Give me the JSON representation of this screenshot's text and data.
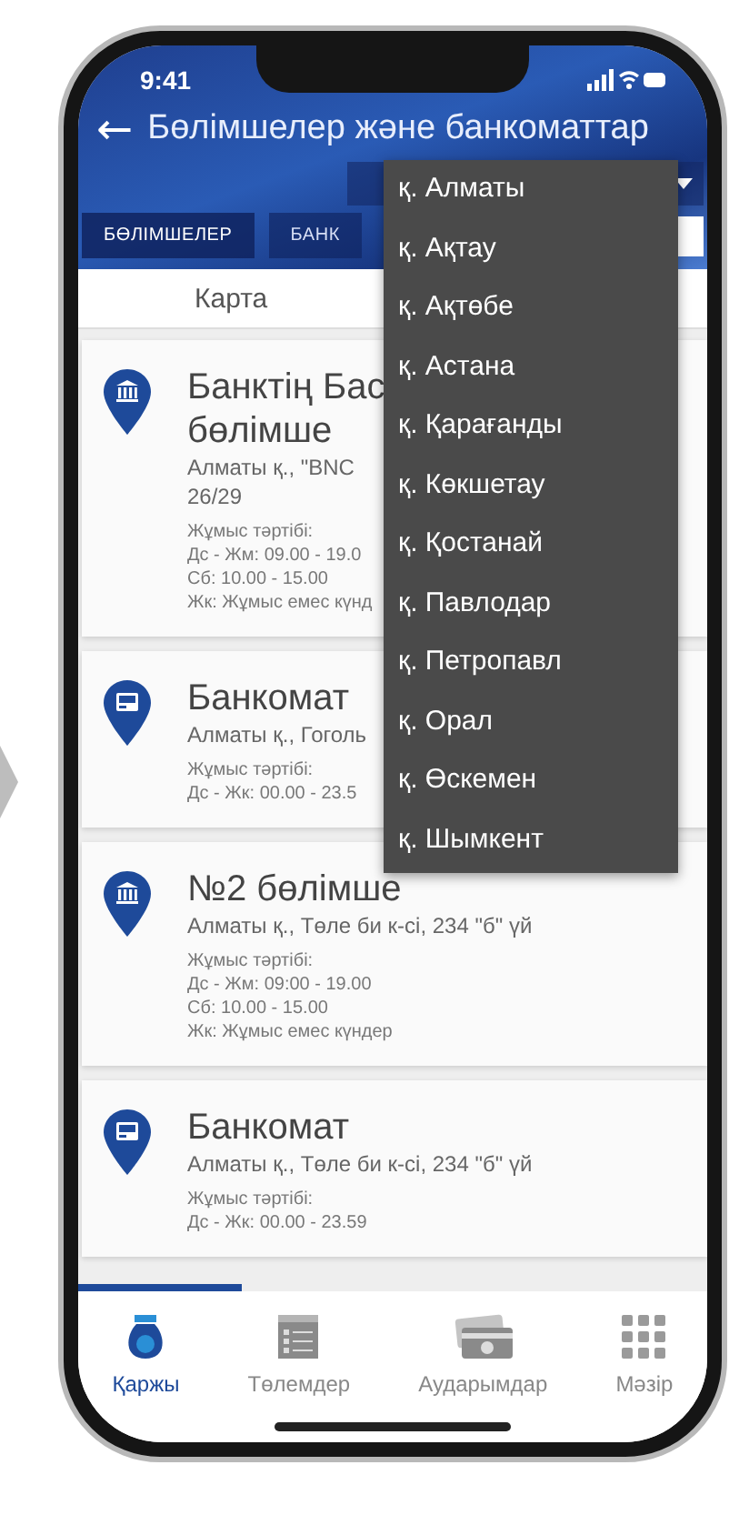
{
  "status_bar": {
    "time": "9:41"
  },
  "header": {
    "title": "Бөлімшелер және банкоматтар",
    "back_icon": "←"
  },
  "tabs": [
    {
      "label": "БӨЛІМШЕЛЕР",
      "selected": true
    },
    {
      "label": "БАНК",
      "selected": false
    }
  ],
  "map_row": {
    "label": "Карта"
  },
  "cards": [
    {
      "kind": "branch",
      "title_lines": [
        "Банктің Бас",
        "бөлімше"
      ],
      "address_lines": [
        "Алматы қ., \"BNC",
        "26/29"
      ],
      "schedule": [
        "Жұмыс тәртібі:",
        "Дс - Жм: 09.00 - 19.0",
        "Сб: 10.00 - 15.00",
        "Жк: Жұмыс емес күнд"
      ]
    },
    {
      "kind": "atm",
      "title_lines": [
        "Банкомат"
      ],
      "address_lines": [
        "Алматы қ., Гоголь"
      ],
      "schedule": [
        "Жұмыс тәртібі:",
        "Дс - Жк: 00.00 - 23.5"
      ]
    },
    {
      "kind": "branch",
      "title_lines": [
        "№2 бөлімше"
      ],
      "address_lines": [
        "Алматы қ., Төле би к-сі, 234 \"б\" үй"
      ],
      "schedule": [
        "Жұмыс тәртібі:",
        "Дс - Жм: 09:00 - 19.00",
        "Сб: 10.00 - 15.00",
        "Жк: Жұмыс емес күндер"
      ]
    },
    {
      "kind": "atm",
      "title_lines": [
        "Банкомат"
      ],
      "address_lines": [
        "Алматы қ., Төле би к-сі, 234 \"б\" үй"
      ],
      "schedule": [
        "Жұмыс тәртібі:",
        "Дс - Жк: 00.00 - 23.59"
      ]
    }
  ],
  "city_dropdown": {
    "options": [
      "қ. Алматы",
      "қ. Ақтау",
      "қ. Ақтөбе",
      "қ. Астана",
      "қ. Қарағанды",
      "қ. Көкшетау",
      "қ. Қостанай",
      "қ. Павлодар",
      "қ. Петропавл",
      "қ. Орал",
      "қ. Өскемен",
      "қ. Шымкент"
    ]
  },
  "bottom_nav": [
    {
      "kind": "finance",
      "label": "Қаржы",
      "selected": true
    },
    {
      "kind": "payments",
      "label": "Төлемдер",
      "selected": false
    },
    {
      "kind": "transfers",
      "label": "Аударымдар",
      "selected": false
    },
    {
      "kind": "menu",
      "label": "Мәзір",
      "selected": false
    }
  ]
}
